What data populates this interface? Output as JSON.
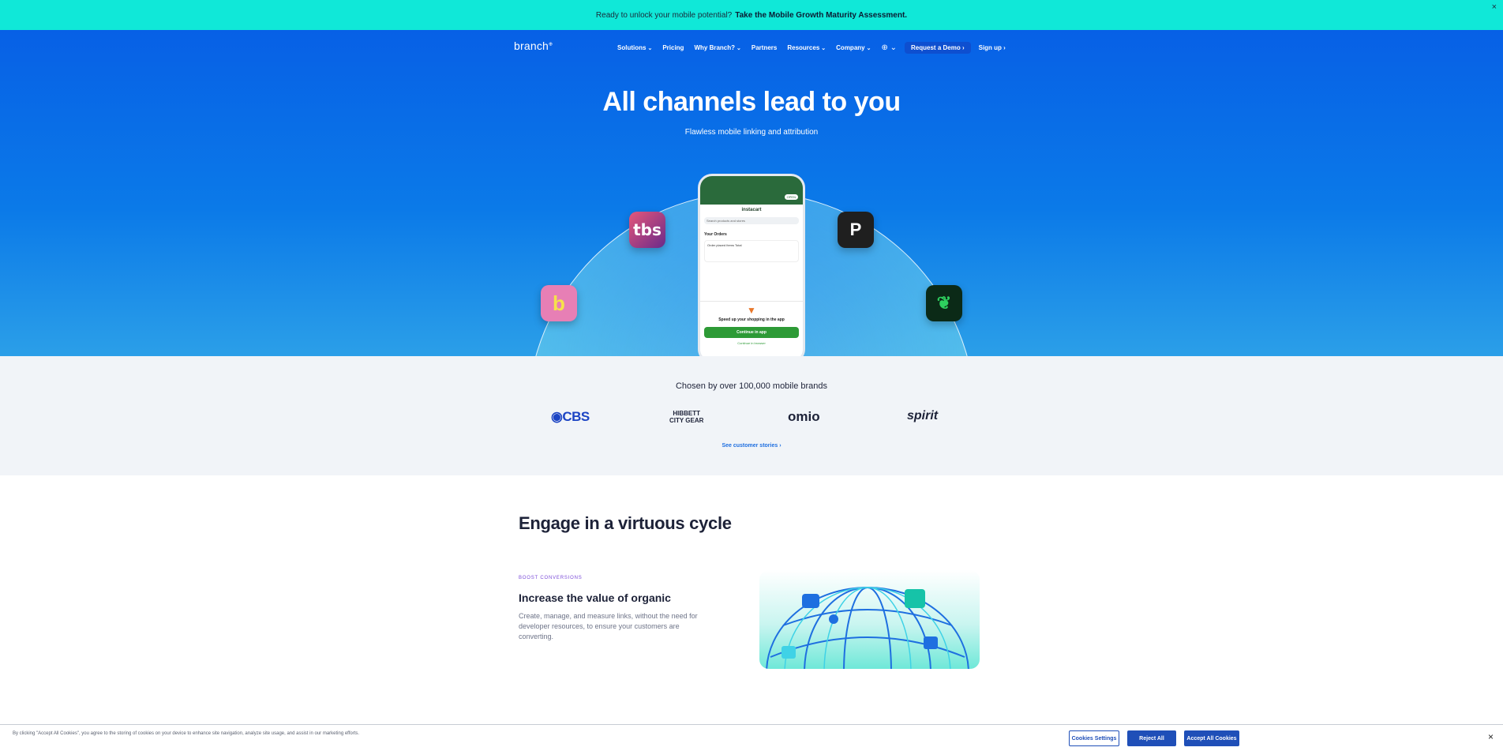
{
  "announcement": {
    "text": "Ready to unlock your mobile potential?",
    "cta": "Take the Mobile Growth Maturity Assessment.",
    "close": "×"
  },
  "nav": {
    "logo": "branch",
    "items": [
      {
        "label": "Solutions",
        "dropdown": true
      },
      {
        "label": "Pricing",
        "dropdown": false
      },
      {
        "label": "Why Branch?",
        "dropdown": true
      },
      {
        "label": "Partners",
        "dropdown": false
      },
      {
        "label": "Resources",
        "dropdown": true
      },
      {
        "label": "Company",
        "dropdown": true
      }
    ],
    "demo_button": "Request a Demo  ›",
    "signup": "Sign up ›"
  },
  "hero": {
    "title": "All channels lead to you",
    "subtitle": "Flawless mobile linking and attribution",
    "phone": {
      "pill": "OPEN",
      "brand": "instacart",
      "search_placeholder": "Search products and stores",
      "orders_heading": "Your Orders",
      "order_text": "Order placed   Items   Total",
      "sheet_message": "Speed up your shopping in the app",
      "sheet_button": "Continue in app",
      "sheet_link": "Continue in browser"
    }
  },
  "brands": {
    "title": "Chosen by over 100,000 mobile brands",
    "logos": {
      "cbs": "◉CBS",
      "hibbett_line1": "HIBBETT",
      "hibbett_line2": "CITY GEAR",
      "omio": "omio",
      "spirit": "spirit"
    },
    "link": "See customer stories ›"
  },
  "content": {
    "section_title": "Engage in a virtuous cycle",
    "kicker": "BOOST CONVERSIONS",
    "feature_title": "Increase the value of organic",
    "feature_body": "Create, manage, and measure links, without the need for developer resources, to ensure your customers are converting."
  },
  "cookie": {
    "text": "By clicking \"Accept All Cookies\", you agree to the storing of cookies on your device to enhance site navigation, analyze site usage, and assist in our marketing efforts.",
    "settings": "Cookies Settings",
    "reject": "Reject All",
    "accept": "Accept All Cookies",
    "close": "×"
  },
  "colors": {
    "announcement_bg": "#10e8d8",
    "hero_blue": "#0760e6",
    "button_blue": "#1f4fb8",
    "kicker_purple": "#7a4ad8"
  }
}
